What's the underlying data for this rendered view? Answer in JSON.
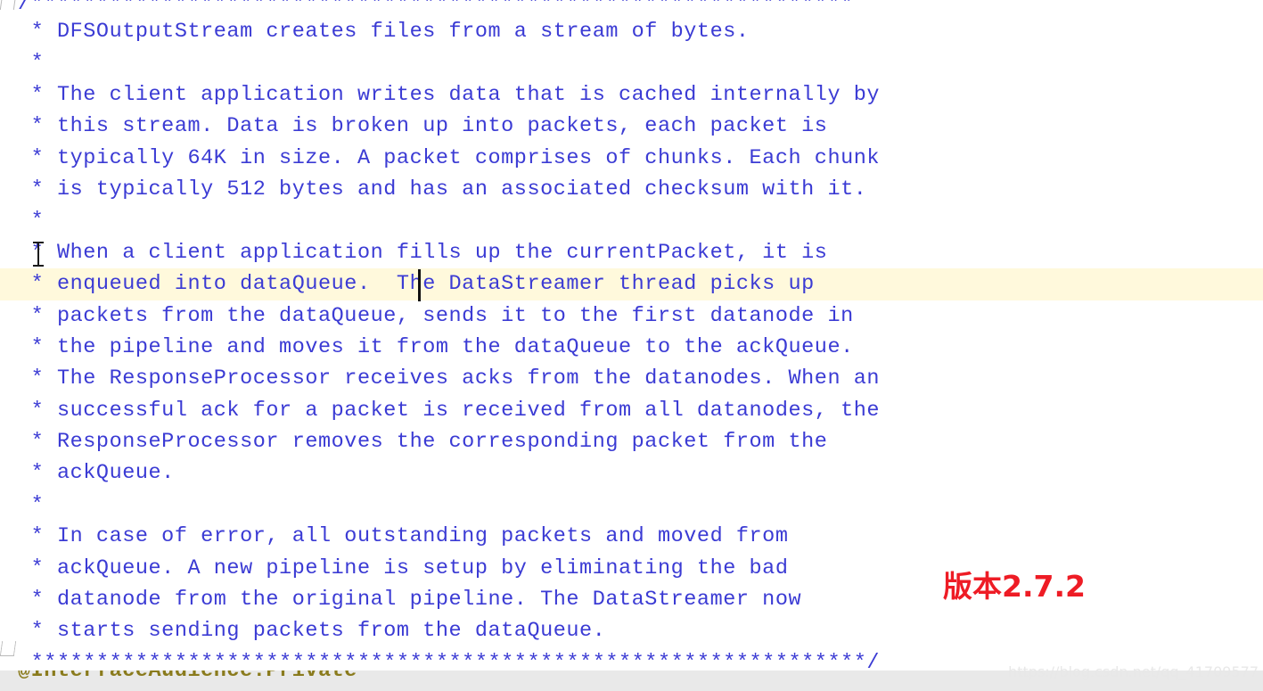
{
  "editor": {
    "language": "java",
    "comment_color": "#3b3bd4",
    "annotation_color": "#8a7b1d",
    "current_line_highlight_color": "#fff9dc",
    "background_color": "#ffffff",
    "lines": [
      {
        "text": "/***************************************************************",
        "type": "comment",
        "current": false
      },
      {
        "text": " * DFSOutputStream creates files from a stream of bytes.",
        "type": "comment",
        "current": false
      },
      {
        "text": " *",
        "type": "comment",
        "current": false
      },
      {
        "text": " * The client application writes data that is cached internally by",
        "type": "comment",
        "current": false
      },
      {
        "text": " * this stream. Data is broken up into packets, each packet is",
        "type": "comment",
        "current": false
      },
      {
        "text": " * typically 64K in size. A packet comprises of chunks. Each chunk",
        "type": "comment",
        "current": false
      },
      {
        "text": " * is typically 512 bytes and has an associated checksum with it.",
        "type": "comment",
        "current": false
      },
      {
        "text": " *",
        "type": "comment",
        "current": false
      },
      {
        "text": " * When a client application fills up the currentPacket, it is",
        "type": "comment",
        "current": false
      },
      {
        "text": " * enqueued into dataQueue.  The DataStreamer thread picks up",
        "type": "comment",
        "current": true
      },
      {
        "text": " * packets from the dataQueue, sends it to the first datanode in",
        "type": "comment",
        "current": false
      },
      {
        "text": " * the pipeline and moves it from the dataQueue to the ackQueue.",
        "type": "comment",
        "current": false
      },
      {
        "text": " * The ResponseProcessor receives acks from the datanodes. When an",
        "type": "comment",
        "current": false
      },
      {
        "text": " * successful ack for a packet is received from all datanodes, the",
        "type": "comment",
        "current": false
      },
      {
        "text": " * ResponseProcessor removes the corresponding packet from the",
        "type": "comment",
        "current": false
      },
      {
        "text": " * ackQueue.",
        "type": "comment",
        "current": false
      },
      {
        "text": " *",
        "type": "comment",
        "current": false
      },
      {
        "text": " * In case of error, all outstanding packets and moved from",
        "type": "comment",
        "current": false
      },
      {
        "text": " * ackQueue. A new pipeline is setup by eliminating the bad",
        "type": "comment",
        "current": false
      },
      {
        "text": " * datanode from the original pipeline. The DataStreamer now",
        "type": "comment",
        "current": false
      },
      {
        "text": " * starts sending packets from the dataQueue.",
        "type": "comment",
        "current": false
      },
      {
        "text": " ****************************************************************/",
        "type": "comment",
        "current": false
      }
    ],
    "clipped_next_line": "@InterfaceAudience.Private"
  },
  "annotations": {
    "version_note": "版本2.7.2",
    "version_note_color": "#ee1c25"
  },
  "watermark": {
    "text": "https://blog.csdn.net/qq_41709577"
  },
  "cursor": {
    "caret_line_index": 9,
    "caret_column": 22,
    "mouse_pointer_icon": "i-beam-cursor"
  },
  "fold_markers": {
    "top_label": "fold-start-marker",
    "bottom_label": "fold-end-marker"
  }
}
